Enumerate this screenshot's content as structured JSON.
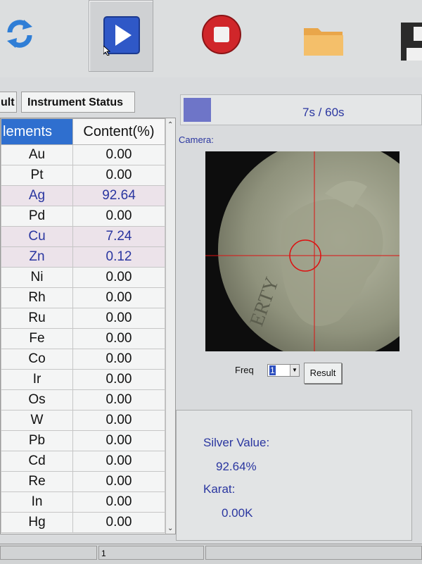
{
  "toolbar": {
    "refresh_icon": "refresh-icon",
    "play_icon": "play-icon",
    "stop_icon": "stop-icon",
    "folder_icon": "folder-icon",
    "save_icon": "save-icon"
  },
  "tabs": [
    {
      "label": "ult"
    },
    {
      "label": "Instrument Status"
    }
  ],
  "progress": {
    "text": "7s / 60s",
    "fraction": 0.117
  },
  "table": {
    "headers": [
      "lements",
      "Content(%)"
    ],
    "rows": [
      {
        "element": "Au",
        "content": "0.00"
      },
      {
        "element": "Pt",
        "content": "0.00"
      },
      {
        "element": "Ag",
        "content": "92.64"
      },
      {
        "element": "Pd",
        "content": "0.00"
      },
      {
        "element": "Cu",
        "content": "7.24"
      },
      {
        "element": "Zn",
        "content": "0.12"
      },
      {
        "element": "Ni",
        "content": "0.00"
      },
      {
        "element": "Rh",
        "content": "0.00"
      },
      {
        "element": "Ru",
        "content": "0.00"
      },
      {
        "element": "Fe",
        "content": "0.00"
      },
      {
        "element": "Co",
        "content": "0.00"
      },
      {
        "element": "Ir",
        "content": "0.00"
      },
      {
        "element": "Os",
        "content": "0.00"
      },
      {
        "element": "W",
        "content": "0.00"
      },
      {
        "element": "Pb",
        "content": "0.00"
      },
      {
        "element": "Cd",
        "content": "0.00"
      },
      {
        "element": "Re",
        "content": "0.00"
      },
      {
        "element": "In",
        "content": "0.00"
      },
      {
        "element": "Hg",
        "content": "0.00"
      }
    ]
  },
  "camera": {
    "label": "Camera:",
    "coin_text": "ERTY"
  },
  "freq": {
    "label": "Freq",
    "value": "1"
  },
  "result_button": "Result",
  "silver": {
    "label": "Silver Value:",
    "value": "92.64%",
    "karat_label": "Karat:",
    "karat_value": "0.00K"
  },
  "statusbar": {
    "page": "1"
  }
}
